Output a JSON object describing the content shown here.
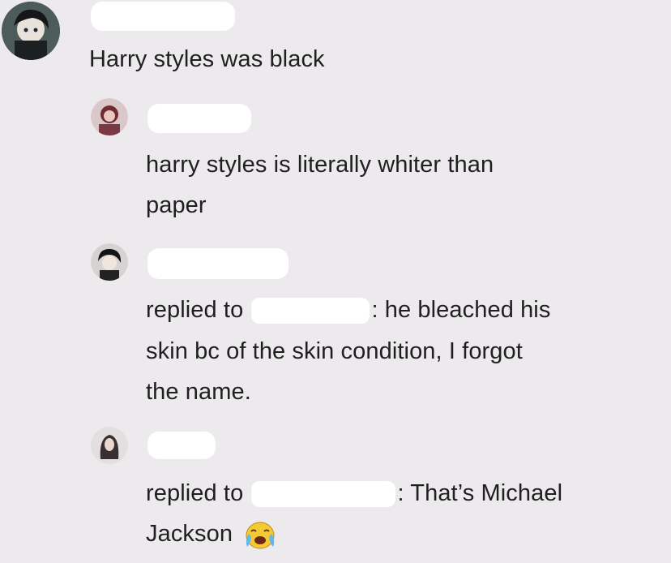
{
  "comments": [
    {
      "text": "Harry styles was black"
    },
    {
      "text_line1": "harry styles is literally whiter than",
      "text_line2": "paper"
    },
    {
      "reply_prefix": "replied to",
      "line1_rest": ": he bleached his",
      "line2": "skin bc of the skin condition, I forgot",
      "line3": "the name."
    },
    {
      "reply_prefix": "replied to",
      "line1_rest": ": That’s Michael",
      "line2": "Jackson"
    }
  ],
  "emoji": "crying-face-icon",
  "colors": {
    "background": "#eceaec",
    "text": "#1f1f1f",
    "redaction": "#ffffff"
  }
}
